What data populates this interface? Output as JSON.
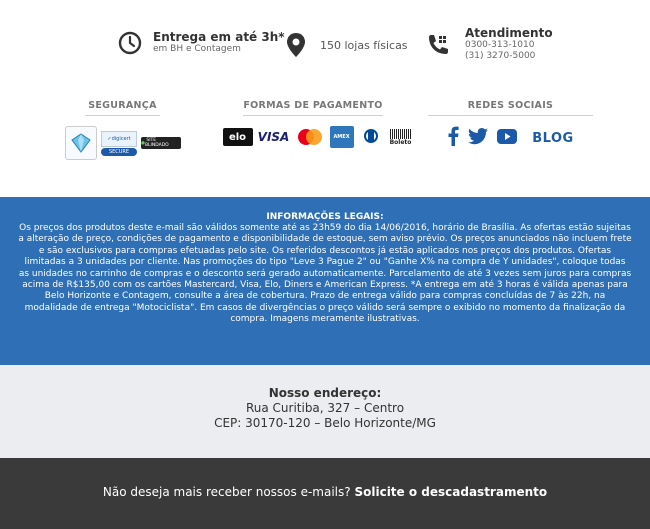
{
  "delivery": {
    "title": "Entrega em até 3h*",
    "subtitle": "em BH e Contagem"
  },
  "stores": {
    "label": "150 lojas físicas"
  },
  "support": {
    "title": "Atendimento",
    "phone1": "0300-313-1010",
    "phone2": "(31) 3270-5000"
  },
  "security": {
    "header": "SEGURANÇA",
    "badges": [
      "Ebit Diamante",
      "digicert Trusted SECURE",
      "SITE BLINDADO"
    ]
  },
  "payment": {
    "header": "FORMAS DE PAGAMENTO",
    "methods": [
      "elo",
      "VISA",
      "MasterCard",
      "American Express",
      "Diners Club",
      "Boleto"
    ]
  },
  "social": {
    "header": "REDES SOCIAIS",
    "blog_label": "BLOG"
  },
  "colors": {
    "blue": "#2e6fb5",
    "facebook": "#3b5998",
    "twitter": "#1da1f2",
    "youtube": "#1b5aa8",
    "footer": "#3a3a3a",
    "address_bg": "#ecedf0"
  },
  "legal": {
    "title": "INFORMAÇÕES LEGAIS:",
    "body": "Os preços dos produtos deste e-mail são válidos somente até as 23h59 do dia 14/06/2016, horário de Brasília. As ofertas estão sujeitas a alteração de preço, condições de pagamento e disponibilidade de estoque, sem aviso prévio. Os preços anunciados não incluem frete e são exclusivos para compras efetuadas pelo site. Os referidos descontos já estão aplicados nos preços dos produtos. Ofertas limitadas a 3 unidades por cliente. Nas promoções do tipo \"Leve 3 Pague 2\" ou \"Ganhe X% na compra de Y unidades\", coloque todas as unidades no carrinho de compras e o desconto será gerado automaticamente. Parcelamento de até 3 vezes sem juros para compras acima de R$135,00 com os cartões Mastercard, Visa, Elo, Diners e American Express. *A entrega em até 3 horas é válida apenas para Belo Horizonte e Contagem, consulte a área de cobertura. Prazo de entrega válido para compras concluídas de 7 às 22h, na modalidade de entrega \"Motociclista\". Em casos de divergências o preço válido será sempre o exibido no momento da finalização da compra. Imagens meramente ilustrativas."
  },
  "address": {
    "title": "Nosso endereço:",
    "line1": "Rua Curitiba, 327 – Centro",
    "line2": "CEP: 30170-120 – Belo Horizonte/MG"
  },
  "footer": {
    "question": "Não deseja mais receber nossos e-mails?",
    "link": "Solicite o descadastramento"
  }
}
